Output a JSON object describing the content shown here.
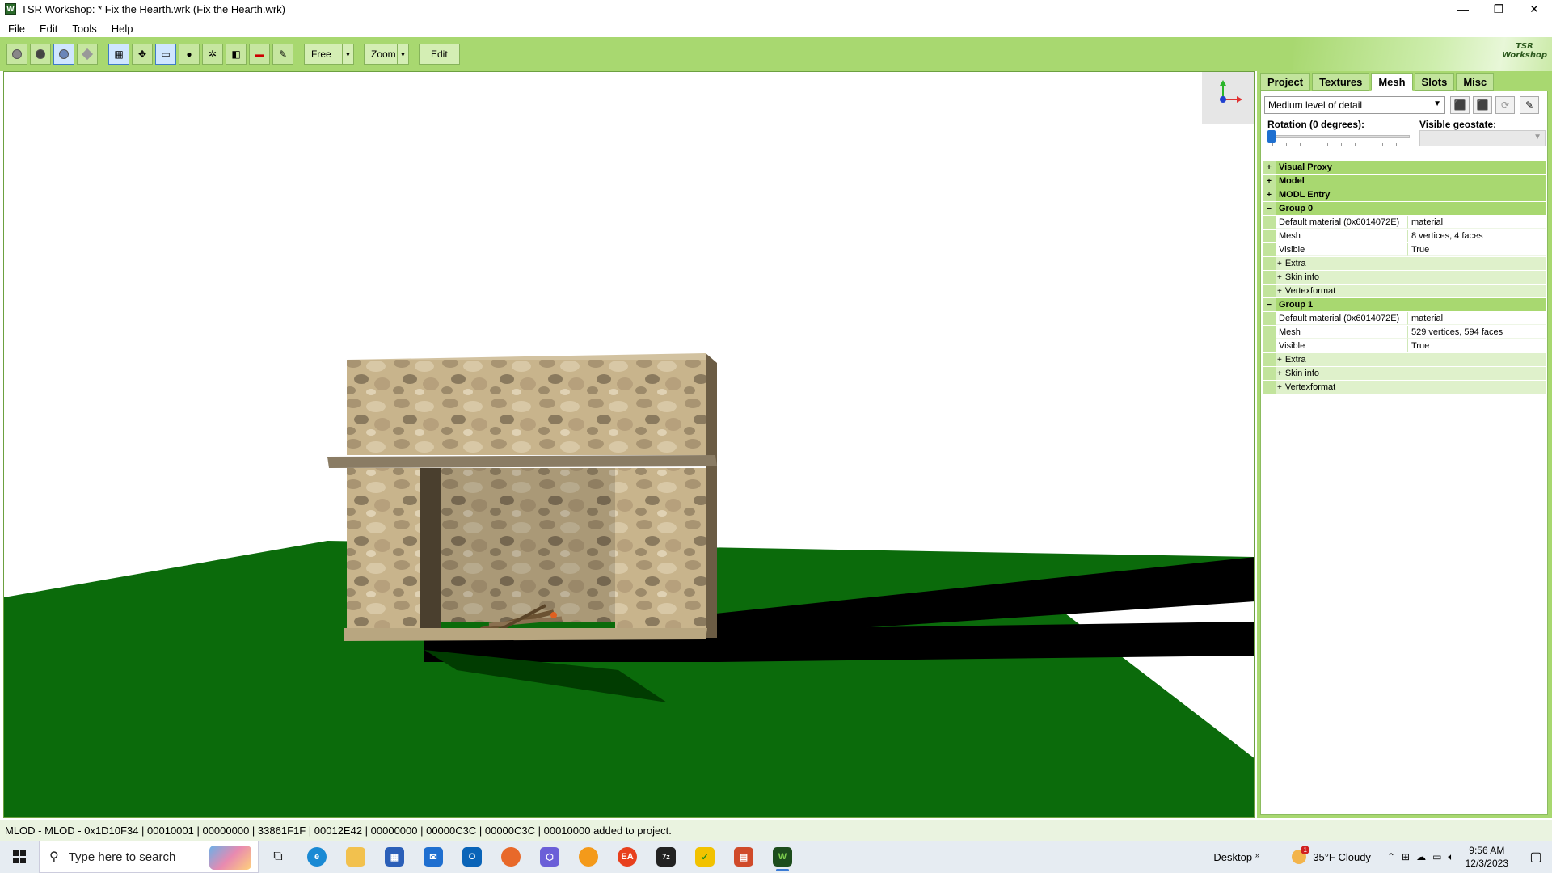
{
  "window": {
    "title": "TSR Workshop: * Fix the Hearth.wrk (Fix the Hearth.wrk)",
    "minimize": "—",
    "restore": "❐",
    "close": "✕"
  },
  "menu": [
    "File",
    "Edit",
    "Tools",
    "Help"
  ],
  "toolbar": {
    "camera_mode": "Free",
    "zoom_mode": "Zoom",
    "edit_label": "Edit",
    "logo_line1": "TSR",
    "logo_line2": "Workshop"
  },
  "panel": {
    "tabs": [
      "Project",
      "Textures",
      "Mesh",
      "Slots",
      "Misc"
    ],
    "active_tab": "Mesh",
    "lod_select": "Medium level of detail",
    "rotation_label": "Rotation (0 degrees):",
    "rotation_value_degrees": 0,
    "geostate_label": "Visible geostate:",
    "tree": {
      "visual_proxy": "Visual Proxy",
      "model": "Model",
      "modl_entry": "MODL Entry",
      "group0": {
        "label": "Group 0",
        "material_key": "Default material (0x6014072E)",
        "material_val": "material",
        "mesh_key": "Mesh",
        "mesh_val": "8 vertices, 4 faces",
        "visible_key": "Visible",
        "visible_val": "True",
        "extra": "Extra",
        "skin": "Skin info",
        "vertex": "Vertexformat"
      },
      "group1": {
        "label": "Group 1",
        "material_key": "Default material (0x6014072E)",
        "material_val": "material",
        "mesh_key": "Mesh",
        "mesh_val": "529 vertices, 594 faces",
        "visible_key": "Visible",
        "visible_val": "True",
        "extra": "Extra",
        "skin": "Skin info",
        "vertex": "Vertexformat"
      }
    }
  },
  "status": "MLOD - MLOD - 0x1D10F34 | 00010001 | 00000000 | 33861F1F | 00012E42 | 00000000 | 00000C3C | 00000C3C | 00010000 added to project.",
  "taskbar": {
    "search_placeholder": "Type here to search",
    "desktop": "Desktop",
    "weather": "35°F  Cloudy",
    "weather_badge": "1",
    "time": "9:56 AM",
    "date": "12/3/2023",
    "chevron": "»"
  },
  "colors": {
    "accent_green": "#a8d870",
    "ground": "#0b6b0b",
    "shadow": "#000000"
  }
}
